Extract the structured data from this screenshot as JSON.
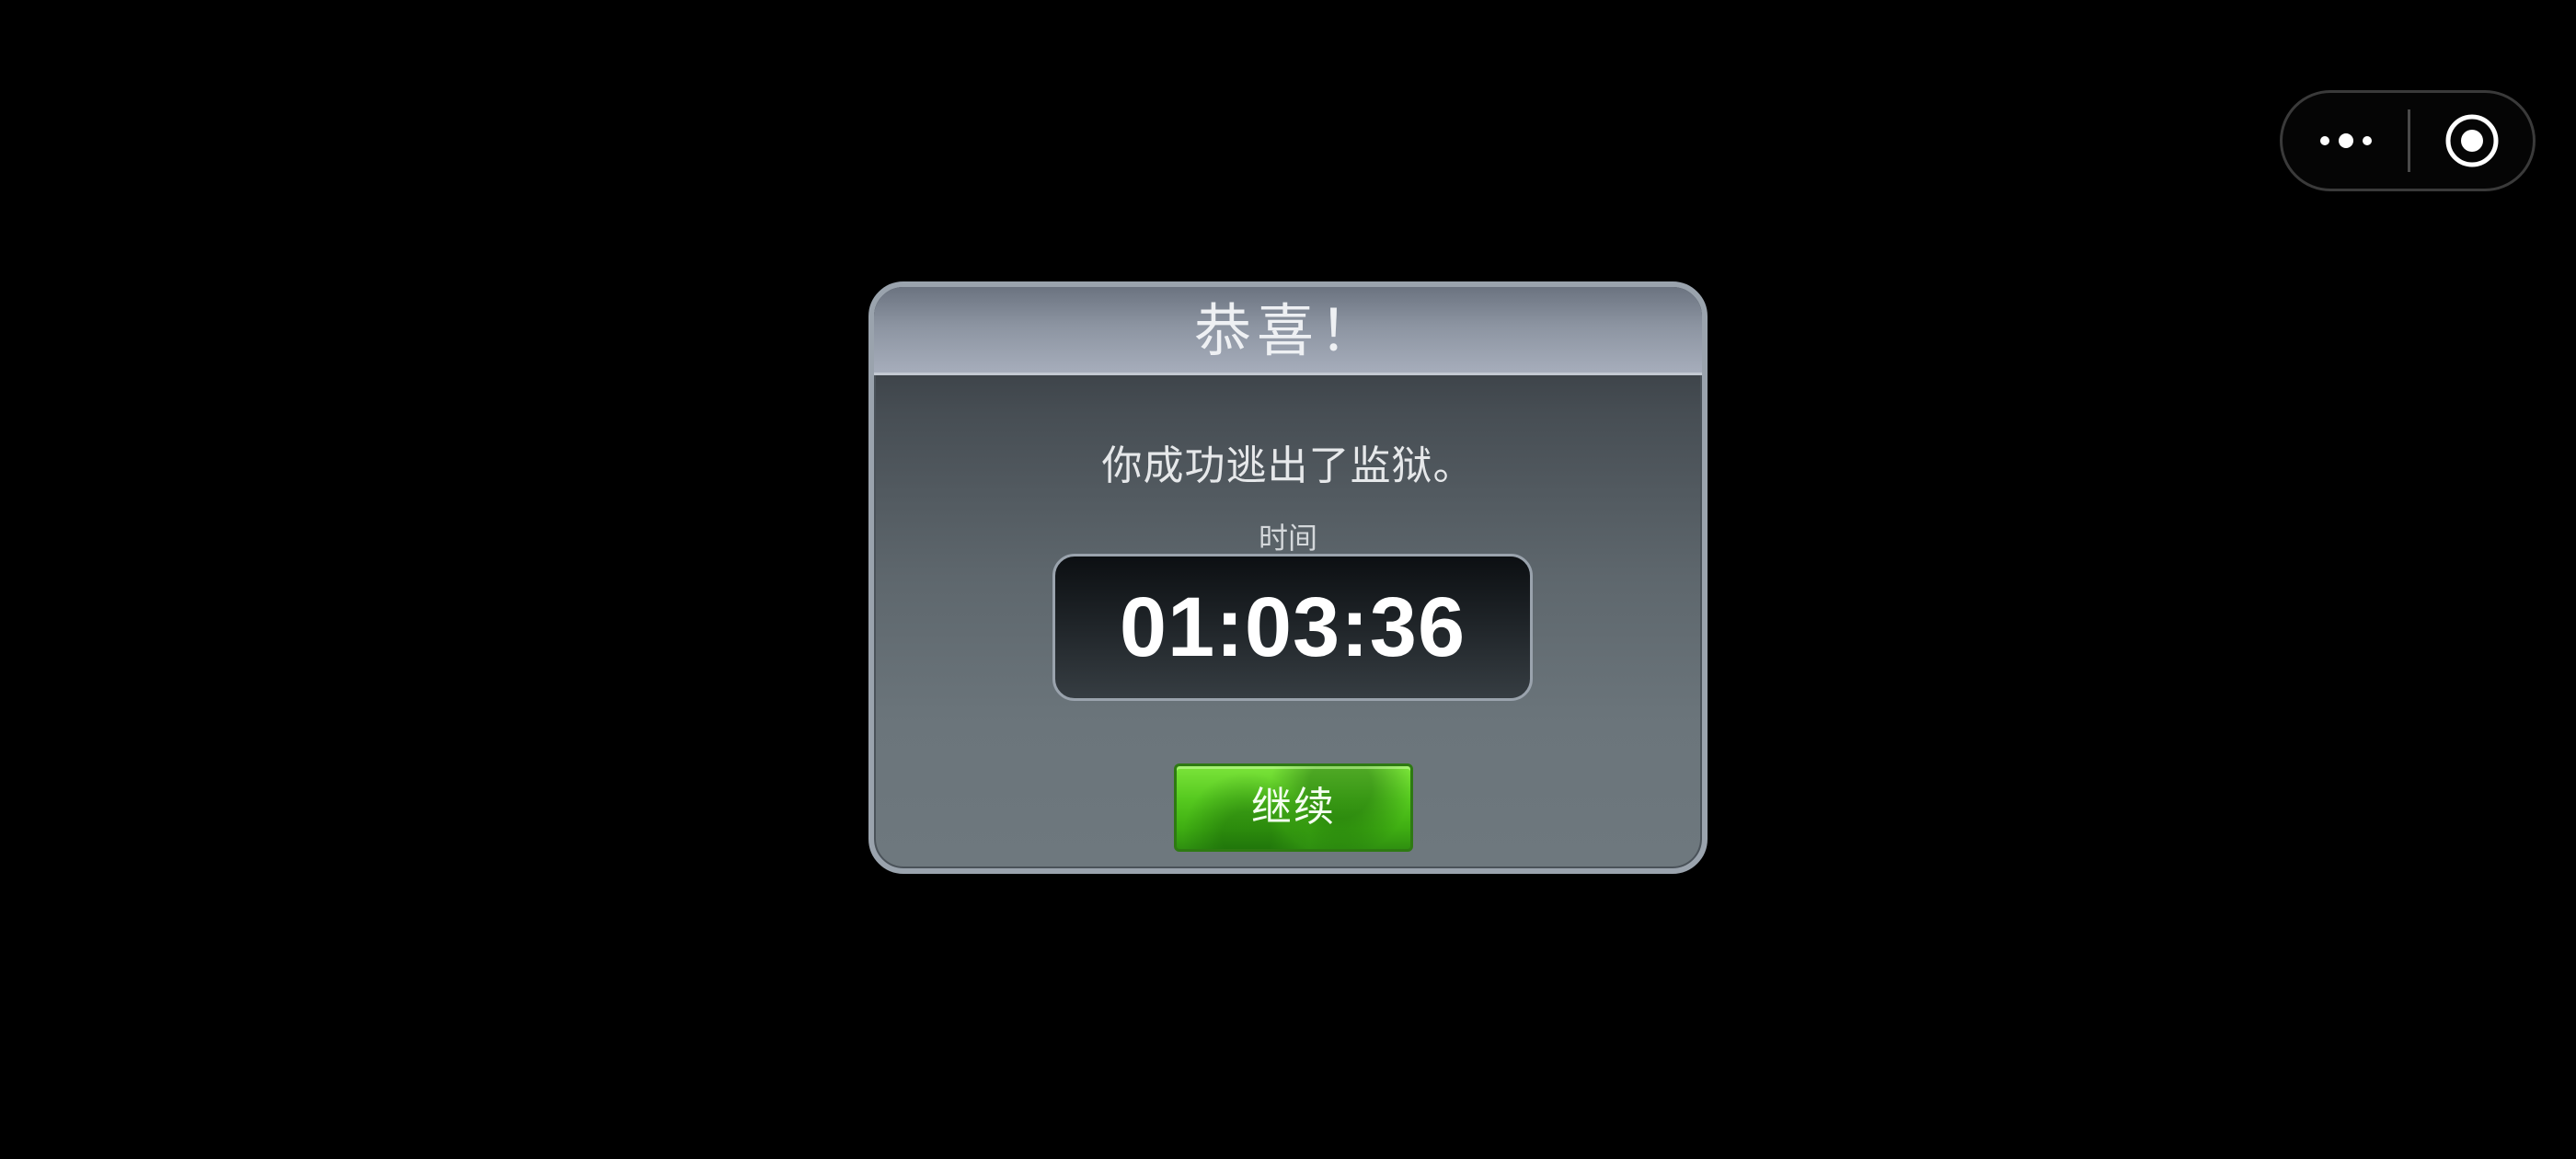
{
  "capsule": {
    "more_icon": "more-dots-icon",
    "close_icon": "target-circle-icon"
  },
  "dialog": {
    "title": "恭喜！",
    "message": "你成功逃出了监狱。",
    "time_label": "时间",
    "time_value": "01:03:36",
    "continue_label": "继续"
  },
  "colors": {
    "background": "#000000",
    "panel_border": "#9aa3ad",
    "header": "#8c94a1",
    "button_green": "#56c91f"
  }
}
